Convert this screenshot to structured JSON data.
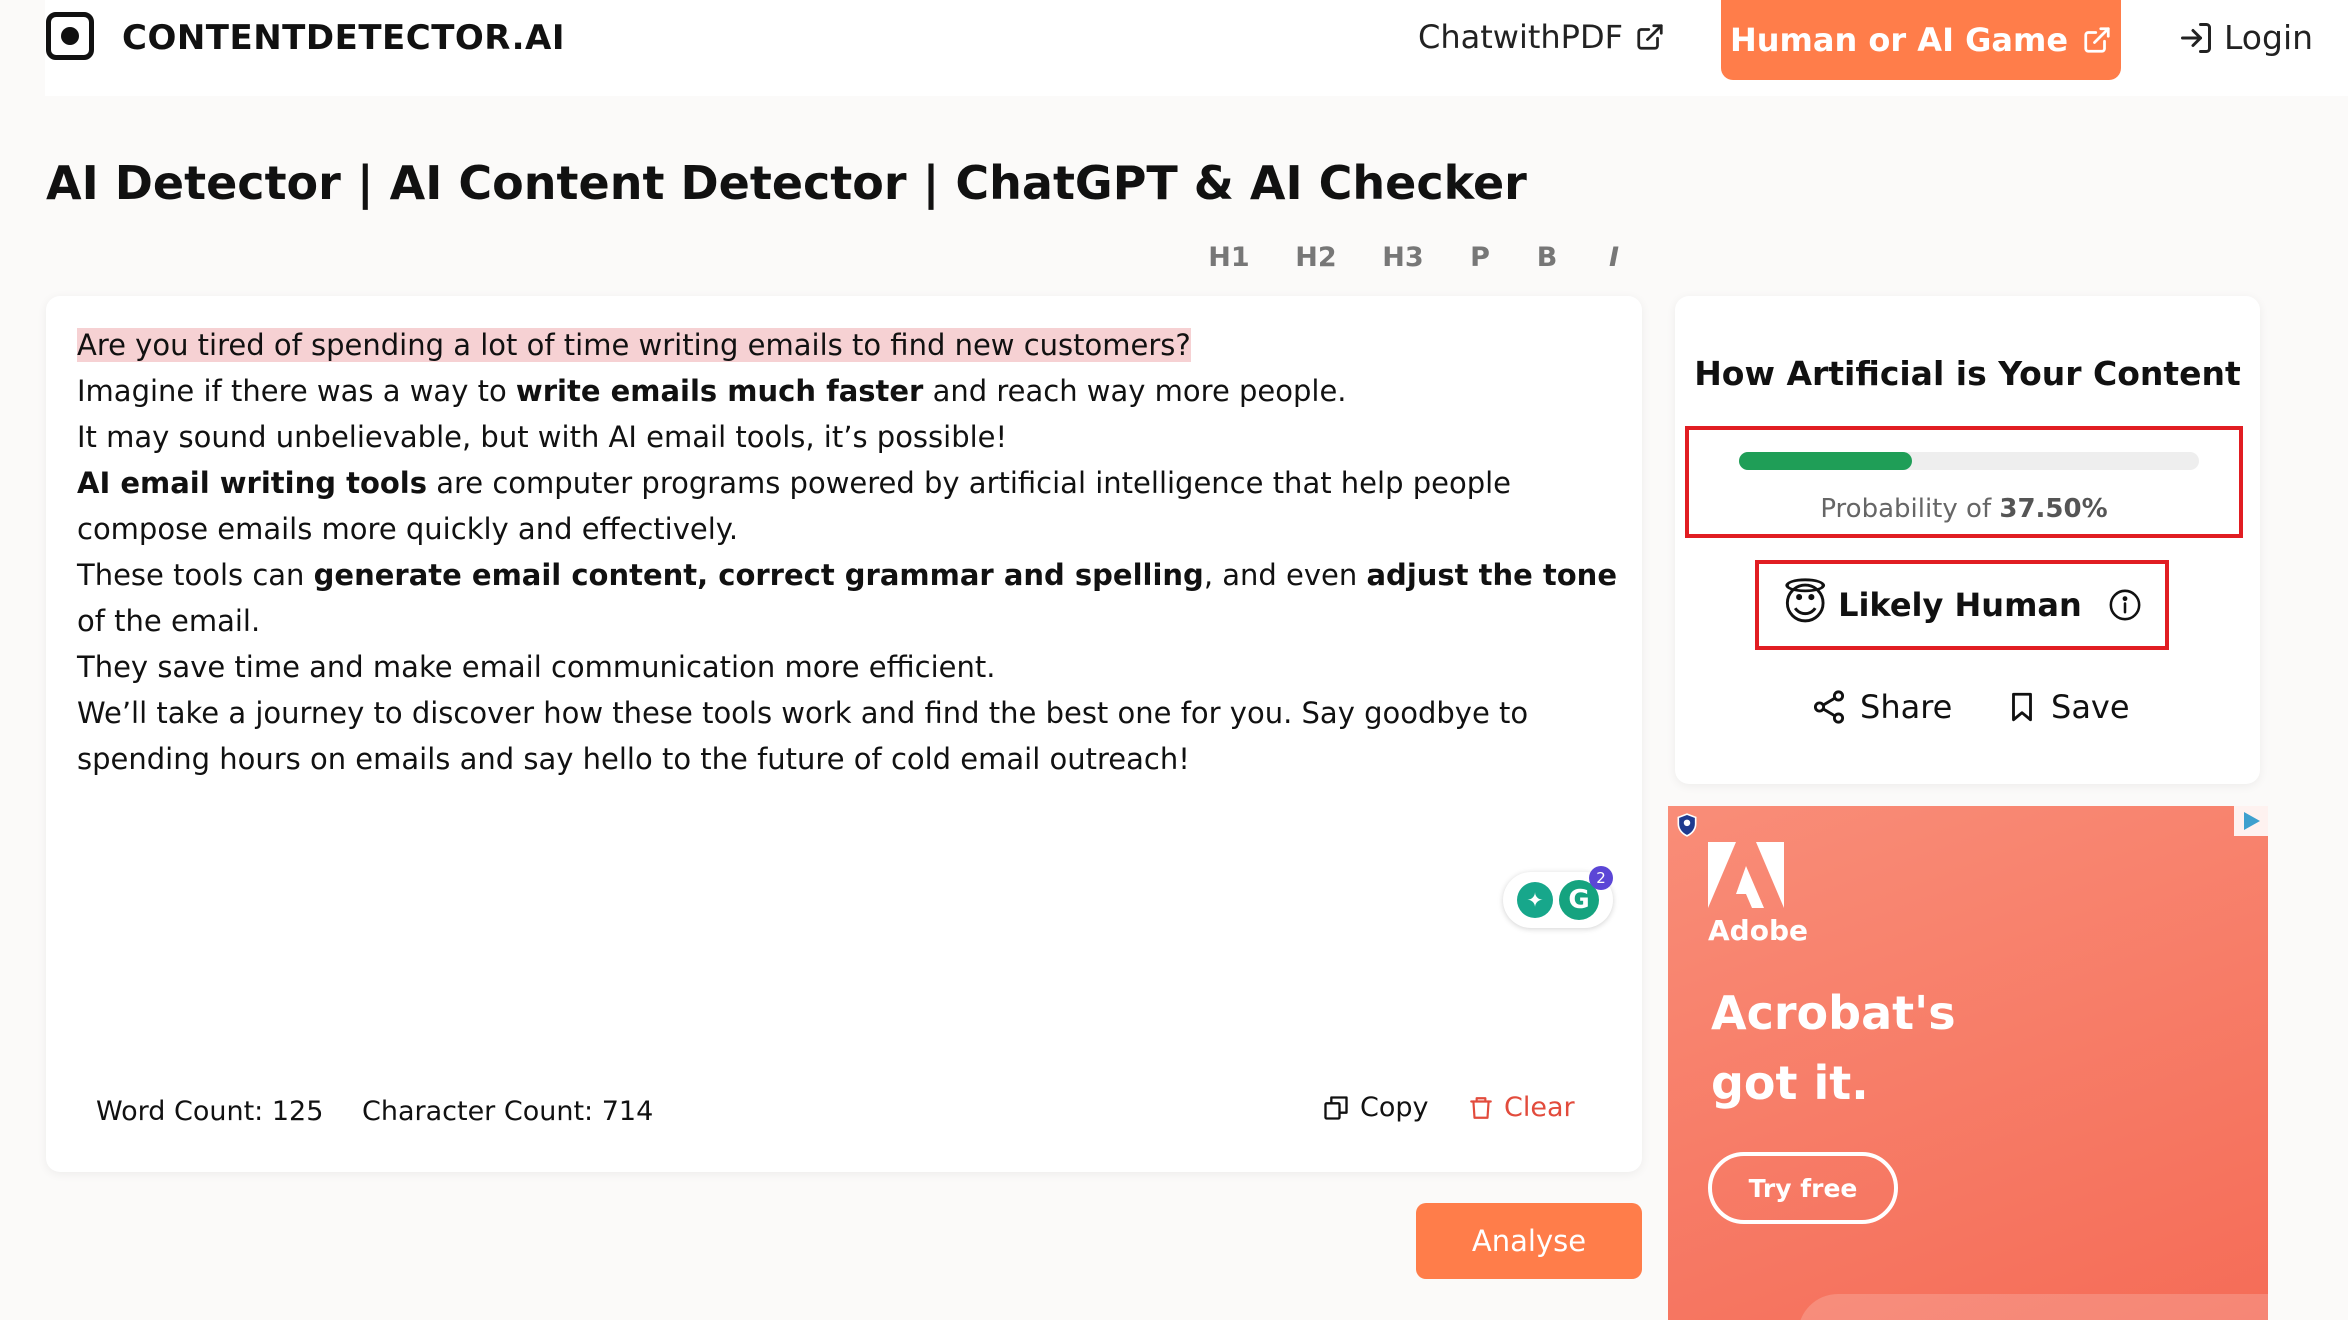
{
  "header": {
    "logo_text": "CONTENTDETECTOR.AI",
    "nav_chatpdf": "ChatwithPDF",
    "nav_game": "Human or AI Game",
    "nav_login": "Login"
  },
  "page_title": "AI Detector | AI Content Detector | ChatGPT & AI Checker",
  "toolbar": {
    "h1": "H1",
    "h2": "H2",
    "h3": "H3",
    "p": "P",
    "b": "B",
    "i": "I"
  },
  "editor": {
    "line1": "Are you tired of spending a lot of time writing emails to find new customers?",
    "line2_pre": "Imagine if there was a way to ",
    "line2_bold": "write emails much faster",
    "line2_post": " and reach way more people.",
    "line3": "It may sound unbelievable, but with AI email tools, it’s possible!",
    "line4_bold": "AI email writing tools",
    "line4_post": " are computer programs powered by artificial intelligence that help people compose emails more quickly and effectively.",
    "line5_pre": "These tools can ",
    "line5_bold1": "generate email content, correct grammar and spelling",
    "line5_mid": ", and even ",
    "line5_bold2": "adjust the tone",
    "line5_post": " of the email.",
    "line6": "They save time and make email communication more efficient.",
    "line7": "We’ll take a journey to discover how these tools work and find the best one for you. Say goodbye to spending hours on emails and say hello to the future of cold email outreach!",
    "grammarly_badge": "2",
    "word_count": "Word Count: 125",
    "char_count": "Character Count: 714",
    "copy_label": "Copy",
    "clear_label": "Clear",
    "analyse_label": "Analyse"
  },
  "result": {
    "title": "How Artificial is Your Content",
    "probability_prefix": "Probability of ",
    "probability_value": "37.50%",
    "probability_fraction": 0.375,
    "verdict_emoji": "😇",
    "verdict": "Likely Human",
    "share_label": "Share",
    "save_label": "Save",
    "bar_color": "#1f9e57",
    "highlight_color": "#e11d22"
  },
  "ad": {
    "brand": "Adobe",
    "headline_line1": "Acrobat's",
    "headline_line2": "got it.",
    "cta": "Try free"
  },
  "colors": {
    "accent": "#ff7d4a",
    "clear": "#e24b3c",
    "highlight": "#f6d1d3",
    "ad_background": "#f56c57"
  }
}
